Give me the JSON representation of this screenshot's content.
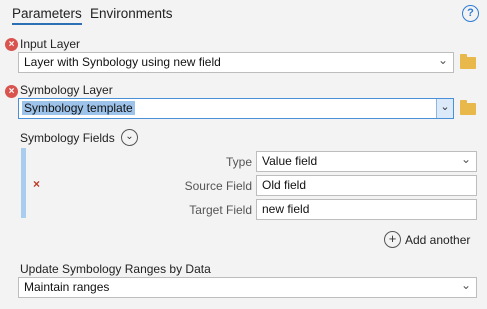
{
  "tabs": {
    "parameters": "Parameters",
    "environments": "Environments"
  },
  "input_layer": {
    "label": "Input Layer",
    "value": "Layer with Synbology using new field"
  },
  "symbology_layer": {
    "label": "Symbology Layer",
    "value": "Symbology template"
  },
  "symbology_fields": {
    "label": "Symbology Fields",
    "type_label": "Type",
    "type_value": "Value field",
    "source_label": "Source Field",
    "source_value": "Old field",
    "target_label": "Target Field",
    "target_value": "new field",
    "add_another": "Add another"
  },
  "update_ranges": {
    "label": "Update Symbology Ranges by Data",
    "value": "Maintain ranges"
  },
  "icons": {
    "help": "?",
    "error": "×",
    "delete": "×",
    "chevron_down": "⌄",
    "plus": "+"
  },
  "colors": {
    "accent": "#2d6fb5",
    "error": "#d9534f",
    "selection": "#9ec3ea",
    "folder": "#e8b84a"
  }
}
